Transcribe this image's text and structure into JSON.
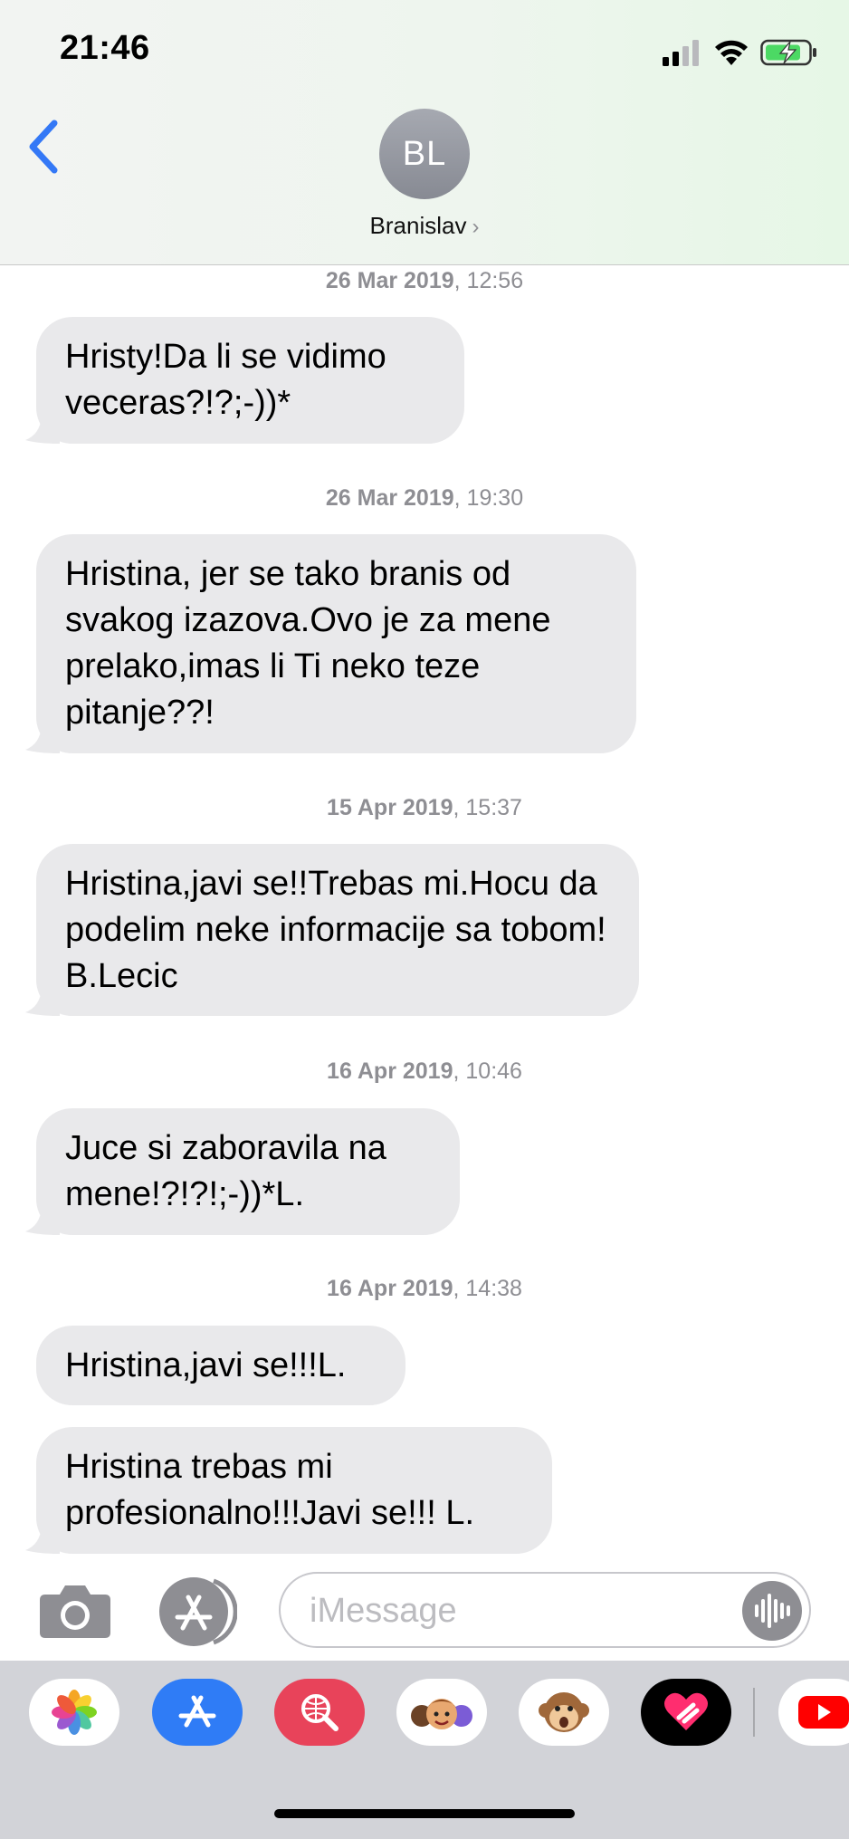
{
  "status_bar": {
    "time": "21:46",
    "signal_icon": "cellular-signal-icon",
    "wifi_icon": "wifi-icon",
    "battery_icon": "battery-charging-icon"
  },
  "header": {
    "back_icon": "chevron-left-icon",
    "avatar_initials": "BL",
    "contact_name": "Branislav",
    "contact_chevron": "›"
  },
  "timestamps": [
    {
      "date": "26 Mar 2019",
      "time": ", 12:56"
    },
    {
      "date": "26 Mar 2019",
      "time": ", 19:30"
    },
    {
      "date": "15 Apr 2019",
      "time": ", 15:37"
    },
    {
      "date": "16 Apr 2019",
      "time": ", 10:46"
    },
    {
      "date": "16 Apr 2019",
      "time": ", 14:38"
    }
  ],
  "messages": [
    {
      "text": "Hristy!Da li se vidimo veceras?!?;-))*"
    },
    {
      "text": "Hristina, jer se tako branis od svakog izazova.Ovo je za mene prelako,imas li Ti neko teze pitanje??!"
    },
    {
      "text": "Hristina,javi se!!Trebas mi.Hocu da podelim neke informacije sa tobom! B.Lecic"
    },
    {
      "text": "Juce si zaboravila na mene!?!?!;-))*L."
    },
    {
      "text": "Hristina,javi se!!!L."
    },
    {
      "text": "Hristina trebas mi profesionalno!!!Javi se!!! L."
    }
  ],
  "composer": {
    "placeholder": "iMessage",
    "camera_icon": "camera-icon",
    "apps_icon": "app-store-icon",
    "audio_icon": "audio-waveform-icon"
  },
  "app_drawer": [
    "photos-icon",
    "app-store-icon",
    "web-search-icon",
    "memoji-icon",
    "animoji-monkey-icon",
    "digital-touch-icon",
    "youtube-icon"
  ],
  "colors": {
    "accent": "#3478f6",
    "bubble": "#e9e9eb",
    "meta_text": "#8e8e93"
  }
}
